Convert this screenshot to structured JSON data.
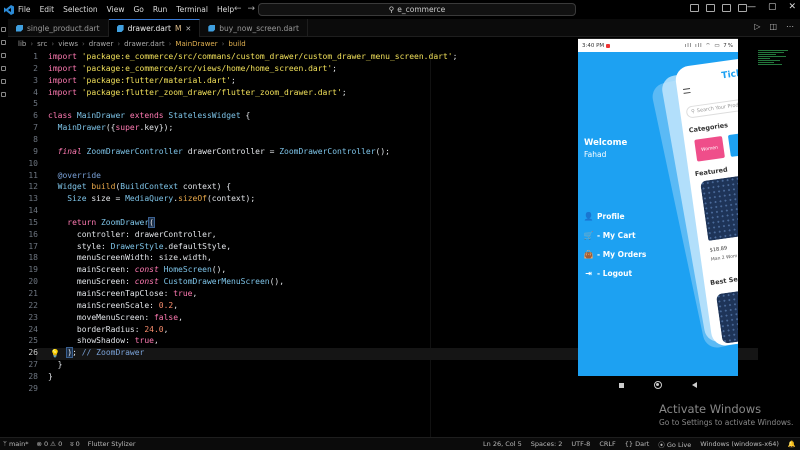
{
  "titlebar": {
    "menu": [
      "File",
      "Edit",
      "Selection",
      "View",
      "Go",
      "Run",
      "Terminal",
      "Help"
    ],
    "search": "e_commerce",
    "controls": {
      "minimize": "—",
      "maximize": "▢",
      "close": "✕"
    }
  },
  "tabs": [
    {
      "label": "single_product.dart",
      "modified": "",
      "active": false
    },
    {
      "label": "drawer.dart",
      "modified": "M",
      "active": true
    },
    {
      "label": "buy_now_screen.dart",
      "modified": "",
      "active": false
    }
  ],
  "breadcrumb": [
    "lib",
    "src",
    "views",
    "drawer",
    "drawer.dart",
    "MainDrawer",
    "build"
  ],
  "code": {
    "current_line": 26,
    "lines": [
      [
        [
          "kw",
          "import "
        ],
        [
          "str",
          "'package:e_commerce/src/commans/custom_drawer/custom_drawer_menu_screen.dart'"
        ],
        [
          "pr",
          ";"
        ]
      ],
      [
        [
          "kw",
          "import "
        ],
        [
          "str",
          "'package:e_commerce/src/views/home/home_screen.dart'"
        ],
        [
          "pr",
          ";"
        ]
      ],
      [
        [
          "kw",
          "import "
        ],
        [
          "str",
          "'package:flutter/material.dart'"
        ],
        [
          "pr",
          ";"
        ]
      ],
      [
        [
          "kw",
          "import "
        ],
        [
          "str",
          "'package:flutter_zoom_drawer/flutter_zoom_drawer.dart'"
        ],
        [
          "pr",
          ";"
        ]
      ],
      [],
      [
        [
          "kw",
          "class "
        ],
        [
          "ty",
          "MainDrawer "
        ],
        [
          "kw",
          "extends "
        ],
        [
          "ty",
          "StatelessWidget "
        ],
        [
          "pr",
          "{"
        ]
      ],
      [
        [
          "pr",
          "  "
        ],
        [
          "ty",
          "MainDrawer"
        ],
        [
          "pr",
          "({"
        ],
        [
          "kw",
          "super"
        ],
        [
          "pr",
          ".key});"
        ]
      ],
      [],
      [
        [
          "pr",
          "  "
        ],
        [
          "it",
          "final "
        ],
        [
          "ty",
          "ZoomDrawerController "
        ],
        [
          "pr",
          "drawerController = "
        ],
        [
          "ty",
          "ZoomDrawerController"
        ],
        [
          "pr",
          "();"
        ]
      ],
      [],
      [
        [
          "pr",
          "  "
        ],
        [
          "at",
          "@override"
        ]
      ],
      [
        [
          "pr",
          "  "
        ],
        [
          "ty",
          "Widget "
        ],
        [
          "fn",
          "build"
        ],
        [
          "pr",
          "("
        ],
        [
          "ty",
          "BuildContext "
        ],
        [
          "pr",
          "context) {"
        ]
      ],
      [
        [
          "pr",
          "    "
        ],
        [
          "ty",
          "Size "
        ],
        [
          "pr",
          "size = "
        ],
        [
          "ty",
          "MediaQuery"
        ],
        [
          "pr",
          "."
        ],
        [
          "fn",
          "sizeOf"
        ],
        [
          "pr",
          "(context);"
        ]
      ],
      [],
      [
        [
          "pr",
          "    "
        ],
        [
          "kw",
          "return "
        ],
        [
          "ty",
          "ZoomDrawer"
        ],
        [
          "br",
          "("
        ]
      ],
      [
        [
          "pr",
          "      controller: drawerController,"
        ]
      ],
      [
        [
          "pr",
          "      style: "
        ],
        [
          "ty",
          "DrawerStyle"
        ],
        [
          "pr",
          ".defaultStyle,"
        ]
      ],
      [
        [
          "pr",
          "      menuScreenWidth: size.width,"
        ]
      ],
      [
        [
          "pr",
          "      mainScreen: "
        ],
        [
          "it",
          "const "
        ],
        [
          "ty",
          "HomeScreen"
        ],
        [
          "pr",
          "(),"
        ]
      ],
      [
        [
          "pr",
          "      menuScreen: "
        ],
        [
          "it",
          "const "
        ],
        [
          "ty",
          "CustomDrawerMenuScreen"
        ],
        [
          "pr",
          "(),"
        ]
      ],
      [
        [
          "pr",
          "      mainScreenTapClose: "
        ],
        [
          "kw",
          "true"
        ],
        [
          "pr",
          ","
        ]
      ],
      [
        [
          "pr",
          "      mainScreenScale: "
        ],
        [
          "num",
          "0.2"
        ],
        [
          "pr",
          ","
        ]
      ],
      [
        [
          "pr",
          "      moveMenuScreen: "
        ],
        [
          "kw",
          "false"
        ],
        [
          "pr",
          ","
        ]
      ],
      [
        [
          "pr",
          "      borderRadius: "
        ],
        [
          "num",
          "24.0"
        ],
        [
          "pr",
          ","
        ]
      ],
      [
        [
          "pr",
          "      showShadow: "
        ],
        [
          "kw",
          "true"
        ],
        [
          "pr",
          ","
        ]
      ],
      [
        [
          "pr",
          "    "
        ],
        [
          "br",
          ")"
        ],
        [
          "pr",
          "; "
        ],
        [
          "cm",
          "// ZoomDrawer"
        ]
      ],
      [
        [
          "pr",
          "  }"
        ]
      ],
      [
        [
          "pr",
          "}"
        ]
      ],
      []
    ]
  },
  "phone": {
    "status_time": "3:40 PM",
    "status_icons": "ıll ıll ⌔ ▭ 7%",
    "welcome": "Welcome",
    "username": "Fahad",
    "drawer_items": [
      {
        "icon": "person-icon",
        "glyph": "👤",
        "label": "Profile"
      },
      {
        "icon": "cart-icon",
        "glyph": "🛒",
        "label": "- My Cart"
      },
      {
        "icon": "bag-icon",
        "glyph": "👜",
        "label": "- My Orders"
      },
      {
        "icon": "logout-icon",
        "glyph": "⇥",
        "label": "- Logout"
      }
    ],
    "home": {
      "brand": "Ticker",
      "search_placeholder": "Search Your Produ",
      "categories_heading": "Categories",
      "category_1": "Women",
      "featured_heading": "Featured",
      "price": "$18.89",
      "product_name": "Man 2 Wom",
      "best_heading": "Best Se"
    }
  },
  "activation": {
    "title": "Activate Windows",
    "subtitle": "Go to Settings to activate Windows."
  },
  "statusbar": {
    "branch": "main*",
    "errors": "⊗ 0 ⚠ 0",
    "ports": "ʬ 0",
    "extension": "Flutter Stylizer",
    "position": "Ln 26, Col 5",
    "spaces": "Spaces: 2",
    "encoding": "UTF-8",
    "eol": "CRLF",
    "language": "{} Dart",
    "golive": "Go Live",
    "device": "Windows (windows-x64)",
    "bell": "🔔"
  },
  "colors": {
    "accent": "#3a7bd5",
    "phone_bg": "#1da1f2"
  }
}
